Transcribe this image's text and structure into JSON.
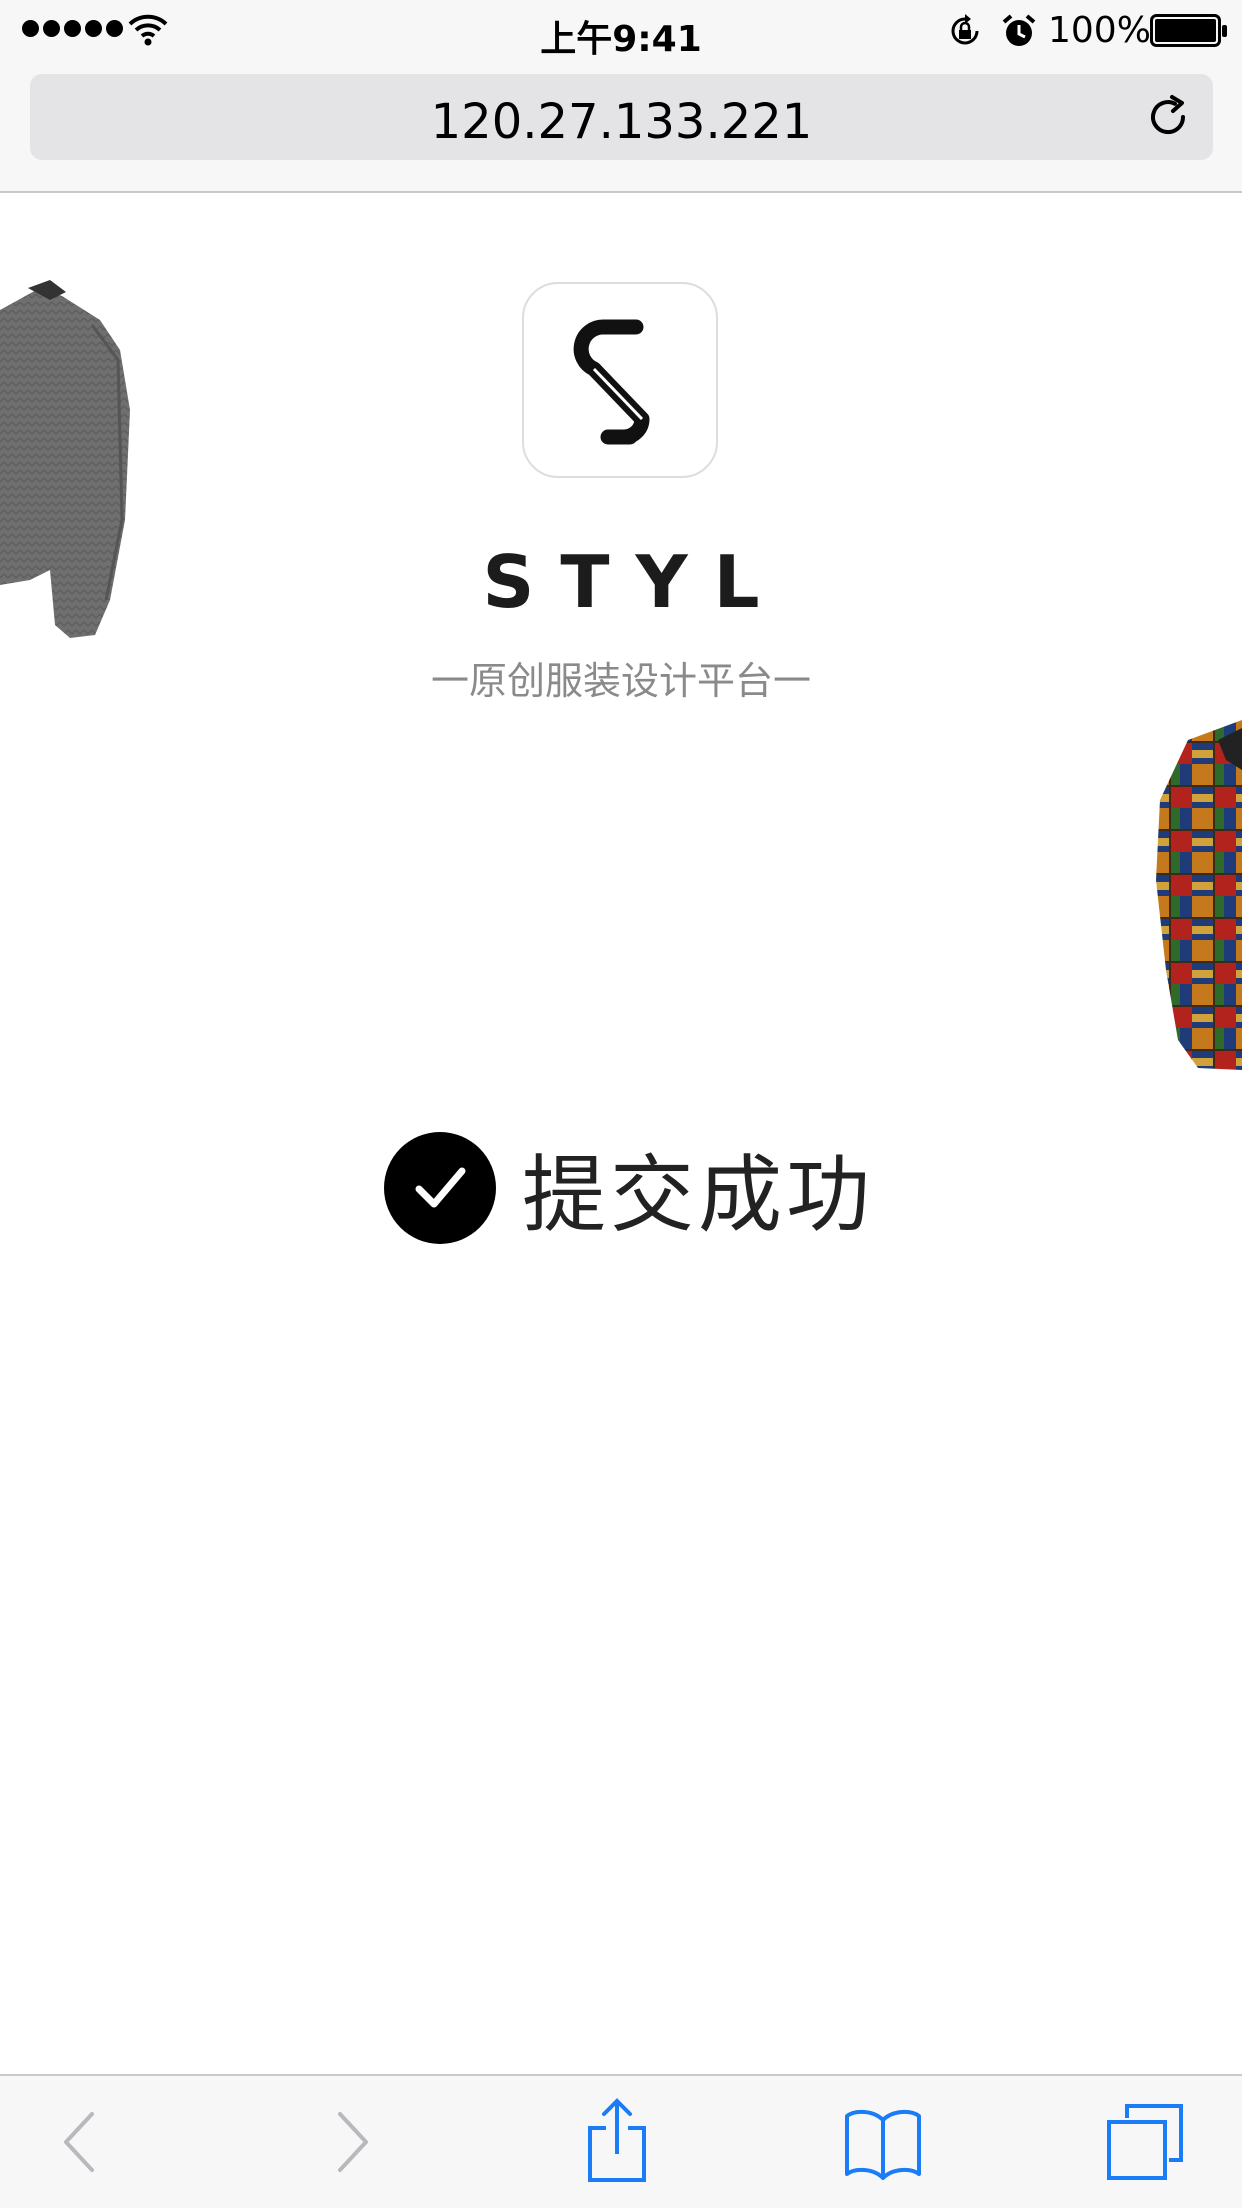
{
  "status_bar": {
    "time": "上午9:41",
    "battery_percent": "100%",
    "signal_bars": 5,
    "icons": [
      "signal-dots",
      "wifi-icon",
      "lock-rotation-icon",
      "alarm-icon",
      "battery-icon"
    ]
  },
  "browser": {
    "url": "120.27.133.221",
    "reload_icon": "reload-icon"
  },
  "page": {
    "brand_name": "STYL",
    "tagline": "一原创服装设计平台一",
    "success_message": "提交成功",
    "logo_icon": "styl-logo-icon",
    "check_icon": "check-circle-icon"
  },
  "toolbar": {
    "buttons": [
      "back-icon",
      "forward-icon",
      "share-icon",
      "bookmarks-icon",
      "tabs-icon"
    ],
    "accent_color": "#1a7cf6",
    "disabled_color": "#b8b8bd"
  }
}
